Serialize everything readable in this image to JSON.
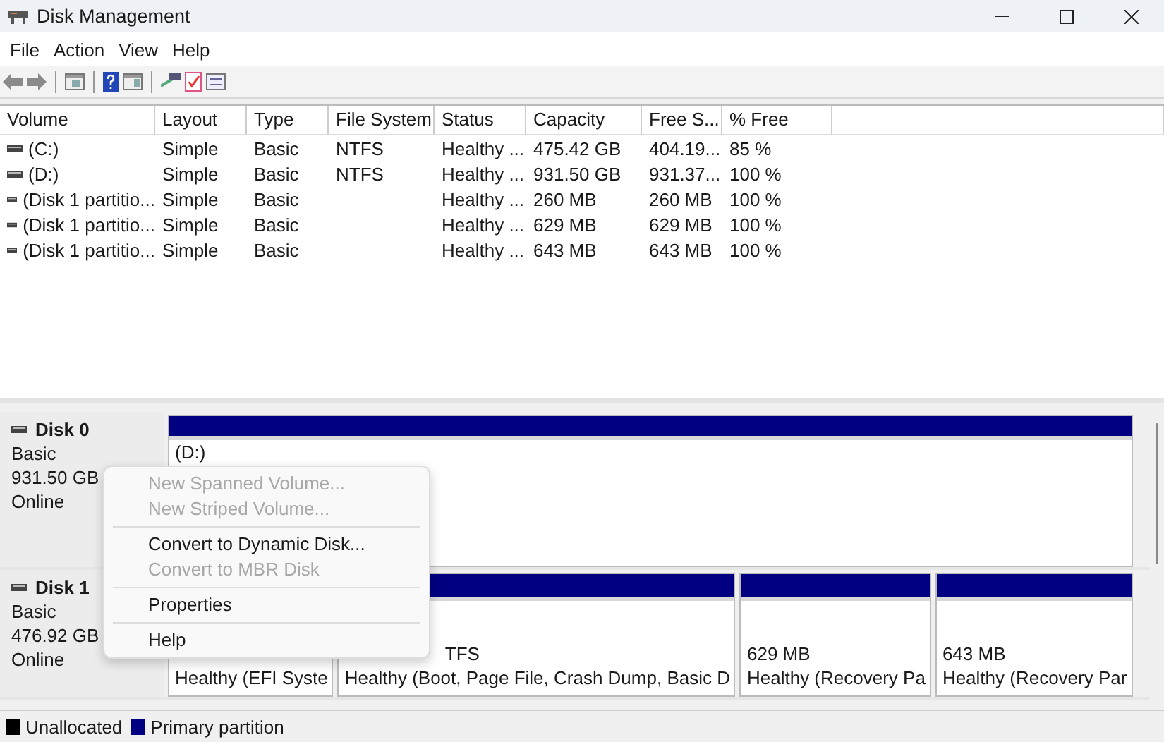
{
  "window": {
    "title": "Disk Management"
  },
  "menu_bar": [
    "File",
    "Action",
    "View",
    "Help"
  ],
  "table": {
    "columns": [
      "Volume",
      "Layout",
      "Type",
      "File System",
      "Status",
      "Capacity",
      "Free S...",
      "% Free"
    ],
    "rows": [
      [
        "(C:)",
        "Simple",
        "Basic",
        "NTFS",
        "Healthy ...",
        "475.42 GB",
        "404.19...",
        "85 %"
      ],
      [
        "(D:)",
        "Simple",
        "Basic",
        "NTFS",
        "Healthy ...",
        "931.50 GB",
        "931.37...",
        "100 %"
      ],
      [
        "(Disk 1 partitio...",
        "Simple",
        "Basic",
        "",
        "Healthy ...",
        "260 MB",
        "260 MB",
        "100 %"
      ],
      [
        "(Disk 1 partitio...",
        "Simple",
        "Basic",
        "",
        "Healthy ...",
        "629 MB",
        "629 MB",
        "100 %"
      ],
      [
        "(Disk 1 partitio...",
        "Simple",
        "Basic",
        "",
        "Healthy ...",
        "643 MB",
        "643 MB",
        "100 %"
      ]
    ]
  },
  "disks": [
    {
      "name": "Disk 0",
      "type": "Basic",
      "size": "931.50 GB",
      "status": "Online",
      "partitions": [
        {
          "lines": [
            "(D:)"
          ],
          "clipped_label": false
        }
      ]
    },
    {
      "name": "Disk 1",
      "type": "Basic",
      "size": "476.92 GB",
      "status": "Online",
      "partitions": [
        {
          "lines": [
            "Healthy (EFI Syste"
          ],
          "clipped_label": false
        },
        {
          "lines": [
            "TFS",
            "Healthy (Boot, Page File, Crash Dump, Basic D"
          ],
          "clipped_label": true
        },
        {
          "lines": [
            "629 MB",
            "Healthy (Recovery Pa"
          ],
          "clipped_label": false
        },
        {
          "lines": [
            "643 MB",
            "Healthy (Recovery Par"
          ],
          "clipped_label": false
        }
      ]
    }
  ],
  "legend": [
    {
      "label": "Unallocated",
      "color": "#000000"
    },
    {
      "label": "Primary partition",
      "color": "#000080"
    }
  ],
  "context_menu": [
    {
      "kind": "item",
      "label": "New Spanned Volume...",
      "disabled": true
    },
    {
      "kind": "item",
      "label": "New Striped Volume...",
      "disabled": true
    },
    {
      "kind": "separator"
    },
    {
      "kind": "item",
      "label": "Convert to Dynamic Disk...",
      "disabled": false
    },
    {
      "kind": "item",
      "label": "Convert to MBR Disk",
      "disabled": true
    },
    {
      "kind": "separator"
    },
    {
      "kind": "item",
      "label": "Properties",
      "disabled": false
    },
    {
      "kind": "separator"
    },
    {
      "kind": "item",
      "label": "Help",
      "disabled": false
    }
  ]
}
